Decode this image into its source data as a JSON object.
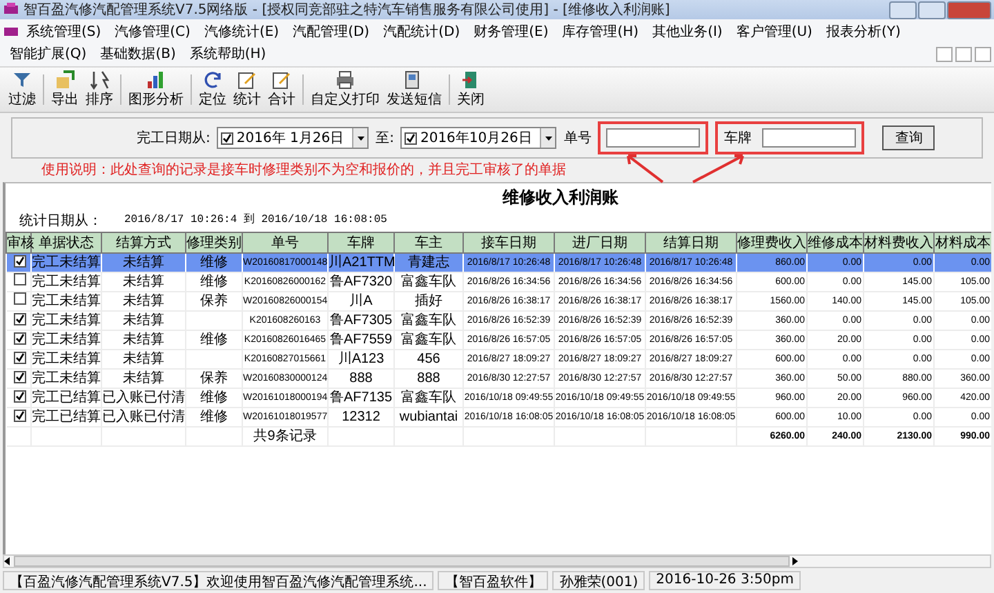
{
  "window": {
    "title": "智百盈汽修汽配管理系统V7.5网络版 - [授权同竞部驻之特汽车销售服务有限公司使用] - [维修收入利润账]"
  },
  "menu": [
    "系统管理(S)",
    "汽修管理(C)",
    "汽修统计(E)",
    "汽配管理(D)",
    "汽配统计(D)",
    "财务管理(E)",
    "库存管理(H)",
    "其他业务(I)",
    "客户管理(U)",
    "报表分析(Y)",
    "智能扩展(Q)",
    "基础数据(B)",
    "系统帮助(H)"
  ],
  "toolbar": [
    "过滤",
    "导出",
    "排序",
    "图形分析",
    "定位",
    "统计",
    "合计",
    "自定义打印",
    "发送短信",
    "关闭"
  ],
  "filter": {
    "date_from_label": "完工日期从:",
    "date_from": {
      "value": "2016年 1月26日",
      "checked": true
    },
    "date_to_label": "至:",
    "date_to": {
      "value": "2016年10月26日",
      "checked": true
    },
    "order_no_label": "单号",
    "plate_label": "车牌",
    "query_button": "查询",
    "note": "使用说明：此处查询的记录是接车时修理类别不为空和报价的，并且完工审核了的单据"
  },
  "report": {
    "title": "维修收入利润账",
    "period_label": "统计日期从：",
    "period": "2016/8/17 10:26:4 到 2016/10/18 16:08:05"
  },
  "table": {
    "columns": [
      "审核",
      "单据状态",
      "结算方式",
      "修理类别",
      "单号",
      "车牌",
      "车主",
      "接车日期",
      "进厂日期",
      "结算日期",
      "修理费收入",
      "维修成本",
      "材料费收入",
      "材料成本"
    ],
    "rows": [
      {
        "checked": true,
        "selected": true,
        "cells": [
          "",
          "完工未结算",
          "未结算",
          "维修",
          "W20160817000148",
          "川A21TTM",
          "青建志",
          "2016/8/17 10:26:48",
          "2016/8/17 10:26:48",
          "2016/8/17 10:26:48",
          "860.00",
          "0.00",
          "0.00",
          "0.00"
        ]
      },
      {
        "checked": false,
        "selected": false,
        "cells": [
          "",
          "完工未结算",
          "未结算",
          "维修",
          "K20160826000162",
          "鲁AF7320",
          "富鑫车队",
          "2016/8/26 16:34:56",
          "2016/8/26 16:34:56",
          "2016/8/26 16:34:56",
          "600.00",
          "0.00",
          "145.00",
          "105.00"
        ]
      },
      {
        "checked": false,
        "selected": false,
        "cells": [
          "",
          "完工未结算",
          "未结算",
          "保养",
          "W20160826000154",
          "川A",
          "插好",
          "2016/8/26 16:38:17",
          "2016/8/26 16:38:17",
          "2016/8/26 16:38:17",
          "1560.00",
          "140.00",
          "145.00",
          "105.00"
        ]
      },
      {
        "checked": true,
        "selected": false,
        "cells": [
          "",
          "完工未结算",
          "未结算",
          "",
          "K201608260163",
          "鲁AF7305",
          "富鑫车队",
          "2016/8/26 16:52:39",
          "2016/8/26 16:52:39",
          "2016/8/26 16:52:39",
          "360.00",
          "0.00",
          "0.00",
          "0.00"
        ]
      },
      {
        "checked": true,
        "selected": false,
        "cells": [
          "",
          "完工未结算",
          "未结算",
          "维修",
          "K20160826016465",
          "鲁AF7559",
          "富鑫车队",
          "2016/8/26 16:57:05",
          "2016/8/26 16:57:05",
          "2016/8/26 16:57:05",
          "360.00",
          "20.00",
          "0.00",
          "0.00"
        ]
      },
      {
        "checked": true,
        "selected": false,
        "cells": [
          "",
          "完工未结算",
          "未结算",
          "",
          "K20160827015661",
          "川A123",
          "456",
          "2016/8/27 18:09:27",
          "2016/8/27 18:09:27",
          "2016/8/27 18:09:27",
          "600.00",
          "0.00",
          "0.00",
          "0.00"
        ]
      },
      {
        "checked": true,
        "selected": false,
        "cells": [
          "",
          "完工未结算",
          "未结算",
          "保养",
          "W20160830000124",
          "888",
          "888",
          "2016/8/30 12:27:57",
          "2016/8/30 12:27:57",
          "2016/8/30 12:27:57",
          "360.00",
          "50.00",
          "880.00",
          "360.00"
        ]
      },
      {
        "checked": true,
        "selected": false,
        "cells": [
          "",
          "完工已结算",
          "已入账已付清",
          "维修",
          "W20161018000194",
          "鲁AF7135",
          "富鑫车队",
          "2016/10/18 09:49:55",
          "2016/10/18 09:49:55",
          "2016/10/18 09:49:55",
          "960.00",
          "20.00",
          "960.00",
          "420.00"
        ]
      },
      {
        "checked": true,
        "selected": false,
        "cells": [
          "",
          "完工已结算",
          "已入账已付清",
          "维修",
          "W20161018019577",
          "12312",
          "wubiantai",
          "2016/10/18 16:08:05",
          "2016/10/18 16:08:05",
          "2016/10/18 16:08:05",
          "600.00",
          "10.00",
          "0.00",
          "0.00"
        ]
      }
    ],
    "totals": {
      "label": "共9条记录",
      "values": [
        "6260.00",
        "240.00",
        "2130.00",
        "990.00"
      ]
    }
  },
  "status_bar": [
    "【百盈汽修汽配管理系统V7.5】欢迎使用智百盈汽修汽配管理系统...",
    "【智百盈软件】",
    "孙雅荣(001)",
    "2016-10-26 3:50pm"
  ]
}
